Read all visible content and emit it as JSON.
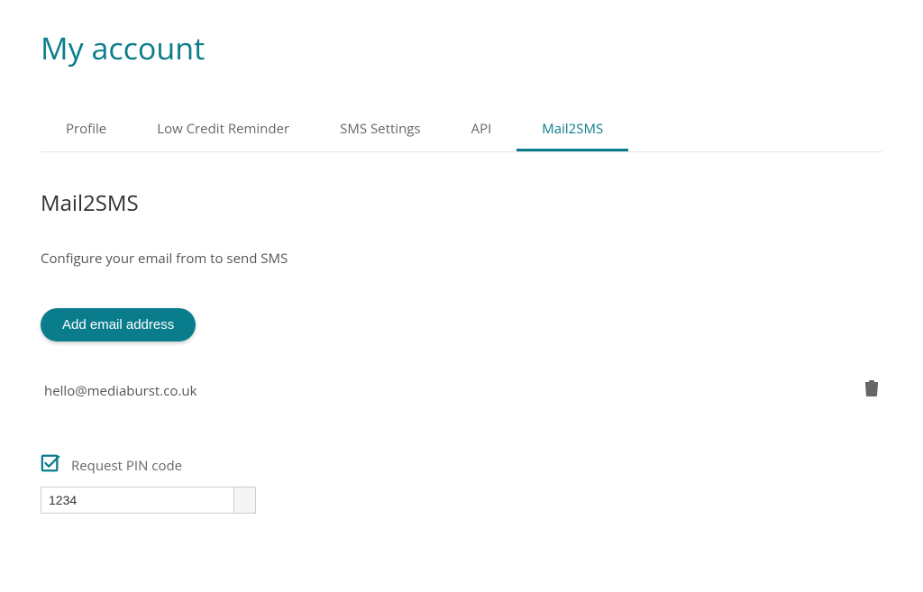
{
  "page": {
    "title": "My account"
  },
  "tabs": [
    {
      "label": "Profile",
      "active": false
    },
    {
      "label": "Low Credit Reminder",
      "active": false
    },
    {
      "label": "SMS Settings",
      "active": false
    },
    {
      "label": "API",
      "active": false
    },
    {
      "label": "Mail2SMS",
      "active": true
    }
  ],
  "section": {
    "title": "Mail2SMS",
    "description": "Configure your email from to send SMS",
    "add_button_label": "Add email address"
  },
  "emails": [
    {
      "address": "hello@mediaburst.co.uk"
    }
  ],
  "pin": {
    "checkbox_label": "Request PIN code",
    "checked": true,
    "value": "1234"
  },
  "colors": {
    "accent": "#0a7d8c"
  }
}
